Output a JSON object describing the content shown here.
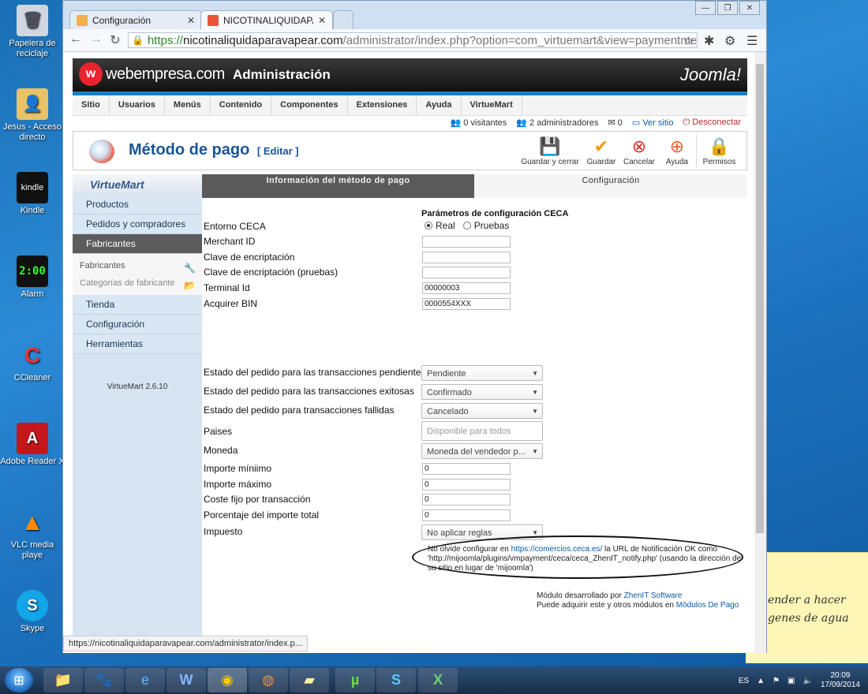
{
  "desktop": {
    "icons": [
      {
        "label": "Papelera de reciclaje",
        "icon": "recycle-bin-icon"
      },
      {
        "label": "Jesus - Acceso directo",
        "icon": "user-folder-icon"
      },
      {
        "label": "Kindle",
        "icon": "kindle-icon"
      },
      {
        "label": "Alarm",
        "icon": "alarm-icon"
      },
      {
        "label": "CCleaner",
        "icon": "ccleaner-icon"
      },
      {
        "label": "Adobe Reader X",
        "icon": "adobe-reader-icon"
      },
      {
        "label": "VLC media playe",
        "icon": "vlc-icon"
      },
      {
        "label": "Skype",
        "icon": "skype-icon"
      }
    ],
    "sticky_note": {
      "line1": "ender a hacer",
      "line2": "genes de agua"
    },
    "kindle_badge": "kindle",
    "alarm_time": "2:00"
  },
  "browser": {
    "tabs": [
      {
        "title": "Configuración",
        "icon": "joomla-tab-icon"
      },
      {
        "title": "NICOTINALIQUIDAPARAVAPEAR",
        "icon": "joomla-tab-icon"
      }
    ],
    "url": {
      "scheme": "https://",
      "host": "nicotinaliquidaparavapear.com",
      "path": "/administrator/index.php?option=com_virtuemart&view=paymentmethod&"
    },
    "status_url": "https://nicotinaliquidaparavapear.com/administrator/index.p..."
  },
  "joomla": {
    "brand": "webempresa.com",
    "brand_icon_letter": "w",
    "admin_title": "Administración",
    "joomla_logo": "Joomla!",
    "menu": [
      "Sitio",
      "Usuarios",
      "Menús",
      "Contenido",
      "Componentes",
      "Extensiones",
      "Ayuda",
      "VirtueMart"
    ],
    "status": {
      "visitors": "0 visitantes",
      "admins": "2 administradores",
      "messages": "0",
      "view_site": "Ver sitio",
      "logout": "Desconectar"
    },
    "page_title": "Método de pago",
    "page_title_sub": "[ Editar ]",
    "toolbar": [
      {
        "label": "Guardar y cerrar",
        "icon": "save-close-icon"
      },
      {
        "label": "Guardar",
        "icon": "save-check-icon"
      },
      {
        "label": "Cancelar",
        "icon": "cancel-icon"
      },
      {
        "label": "Ayuda",
        "icon": "help-lifebuoy-icon"
      },
      {
        "label": "Permisos",
        "icon": "permissions-lock-icon"
      }
    ]
  },
  "sidebar": {
    "logo": "VirtueMart",
    "items_top": [
      "Productos",
      "Pedidos y compradores",
      "Fabricantes"
    ],
    "subitems": [
      "Fabricantes",
      "Categorías de fabricante"
    ],
    "items_bottom": [
      "Tienda",
      "Configuración",
      "Herramientas"
    ],
    "version": "VirtueMart 2.6.10"
  },
  "tabs": {
    "info": "Información del método de pago",
    "config": "Configuración"
  },
  "form": {
    "section_title": "Parámetros de configuración CECA",
    "entorno_label": "Entorno CECA",
    "entorno_options": [
      "Real",
      "Pruebas"
    ],
    "merchant_label": "Merchant ID",
    "clave_label": "Clave de encriptación",
    "clave_pruebas_label": "Clave de encriptación (pruebas)",
    "terminal_label": "Terminal Id",
    "terminal_value": "00000003",
    "acquirer_label": "Acquirer BIN",
    "acquirer_value": "0000554XXX",
    "pendiente_label": "Estado del pedido para las transacciones pendientes",
    "pendiente_value": "Pendiente",
    "exitosas_label": "Estado del pedido para las transacciones exitosas",
    "exitosas_value": "Confirmado",
    "fallidas_label": "Estado del pedido para transacciones fallidas",
    "fallidas_value": "Cancelado",
    "paises_label": "Paises",
    "paises_placeholder": "Disponible para todos",
    "moneda_label": "Moneda",
    "moneda_value": "Moneda del vendedor p...",
    "min_label": "Importe míniimo",
    "min_value": "0",
    "max_label": "Importe máximo",
    "max_value": "0",
    "coste_label": "Coste fijo por transacción",
    "coste_value": "0",
    "porcentaje_label": "Porcentaje del importe total",
    "porcentaje_value": "0",
    "impuesto_label": "Impuesto",
    "impuesto_value": "No aplicar reglas",
    "note_prefix": "No olvide configurar en ",
    "note_link": "https://comercios.ceca.es/",
    "note_suffix": " la URL de Notificación OK como 'http://mijoomla/plugins/vmpayment/ceca/ceca_ZhenIT_notify.php' (usando la dirección de su sitio en lugar de 'mijoomla')",
    "credit1_prefix": "Módulo desarrollado por ",
    "credit1_link": "ZhenIT Software",
    "credit2_prefix": "Puede adquirir este y otros módulos en ",
    "credit2_link": "Módulos De Pago"
  },
  "taskbar": {
    "apps": [
      "explorer-icon",
      "gimp-icon",
      "ie-icon",
      "word-icon",
      "chrome-icon",
      "firefox-icon",
      "sticky-notes-icon",
      "utorrent-icon",
      "skype-icon",
      "excel-icon"
    ],
    "lang": "ES",
    "time": "20:09",
    "date": "17/09/2014"
  }
}
